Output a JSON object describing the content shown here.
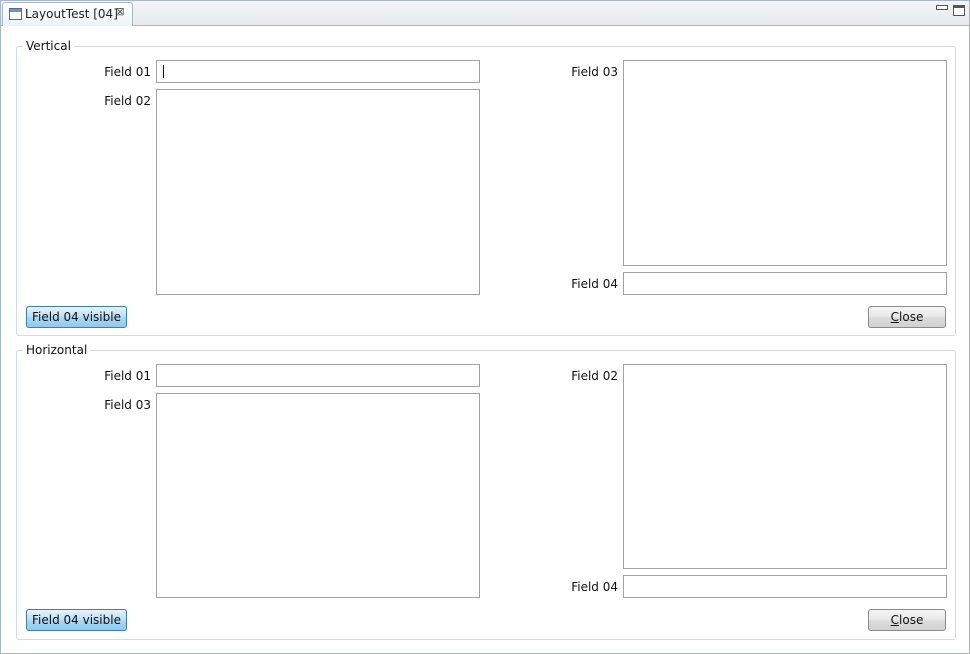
{
  "tab": {
    "title": "LayoutTest [04]",
    "close_glyph": "⊠"
  },
  "window_controls": {
    "minimize_icon": "minimize-icon",
    "maximize_icon": "maximize-icon"
  },
  "vertical": {
    "legend": "Vertical",
    "field01_label": "Field 01",
    "field02_label": "Field 02",
    "field03_label": "Field 03",
    "field04_label": "Field 04",
    "toggle_button": "Field 04 visible",
    "close_button_mnemonic": "C",
    "close_button_rest": "lose"
  },
  "horizontal": {
    "legend": "Horizontal",
    "field01_label": "Field 01",
    "field02_label": "Field 02",
    "field03_label": "Field 03",
    "field04_label": "Field 04",
    "toggle_button": "Field 04 visible",
    "close_button_mnemonic": "C",
    "close_button_rest": "lose"
  },
  "colors": {
    "window_border": "#a9b6c4",
    "group_border": "#d5dbe2",
    "field_border": "#a0a4a8",
    "blue_button": "#8ecaf0"
  }
}
